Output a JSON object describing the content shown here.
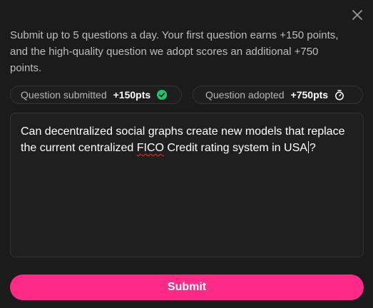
{
  "dialog": {
    "close_icon": "close-icon",
    "intro_text": "Submit up to 5 questions a day. Your first question earns +150 points, and the high-quality question we adopt scores an additional +750 points."
  },
  "badges": {
    "submitted": {
      "label": "Question submitted",
      "points": "+150pts",
      "icon": "check-circle-icon",
      "icon_color": "#1ec46b"
    },
    "adopted": {
      "label": "Question adopted",
      "points": "+750pts",
      "icon": "stopwatch-icon"
    }
  },
  "question": {
    "text_part1": "Can decentralized social graphs create new models that replace the current centralized ",
    "misspelled_word": "FICO",
    "text_part2": " Credit rating system in USA",
    "text_part3": "?"
  },
  "submit": {
    "label": "Submit",
    "color": "#ff2a87"
  }
}
